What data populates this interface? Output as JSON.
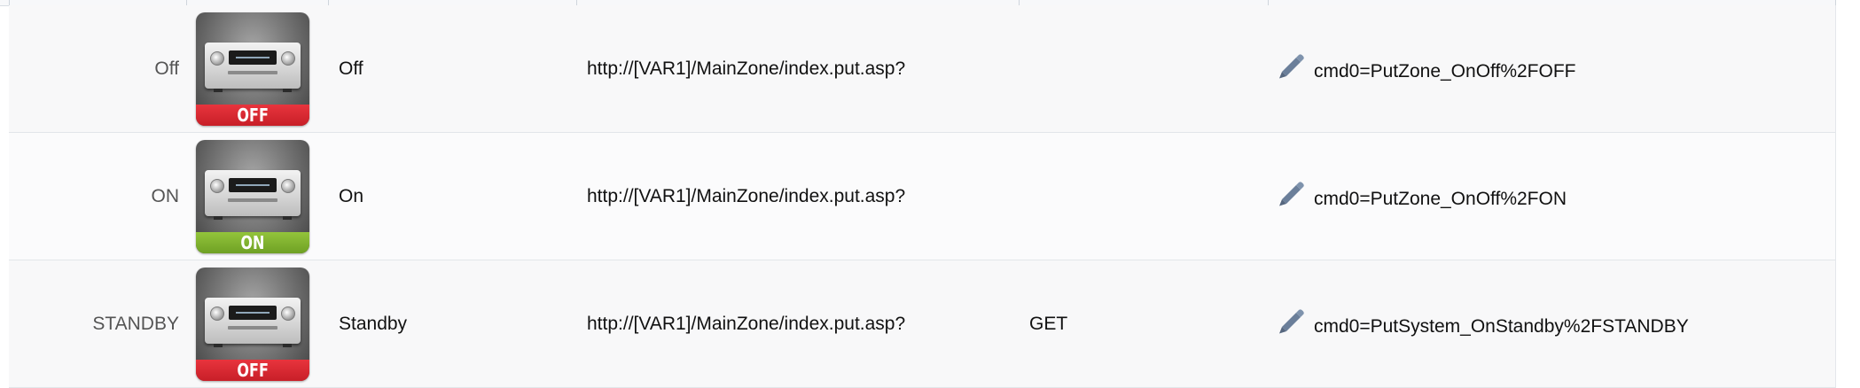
{
  "table": {
    "rows": [
      {
        "name": "Off",
        "icon": "receiver-off-icon",
        "state_label": "OFF",
        "state_color": "#d42a33",
        "label": "Off",
        "url": "http://[VAR1]/MainZone/index.put.asp?",
        "method": "",
        "data": "cmd0=PutZone_OnOff%2FOFF"
      },
      {
        "name": "ON",
        "icon": "receiver-on-icon",
        "state_label": "ON",
        "state_color": "#7fae2c",
        "label": "On",
        "url": "http://[VAR1]/MainZone/index.put.asp?",
        "method": "",
        "data": "cmd0=PutZone_OnOff%2FON"
      },
      {
        "name": "STANDBY",
        "icon": "receiver-off-icon",
        "state_label": "OFF",
        "state_color": "#d42a33",
        "label": "Standby",
        "url": "http://[VAR1]/MainZone/index.put.asp?",
        "method": "GET",
        "data": "cmd0=PutSystem_OnStandby%2FSTANDBY"
      }
    ]
  },
  "colors": {
    "pencil": "#6b7f9a",
    "row_border": "#e2e6ea",
    "name_text": "#555555"
  },
  "icons": {
    "edit": "pencil-icon"
  }
}
